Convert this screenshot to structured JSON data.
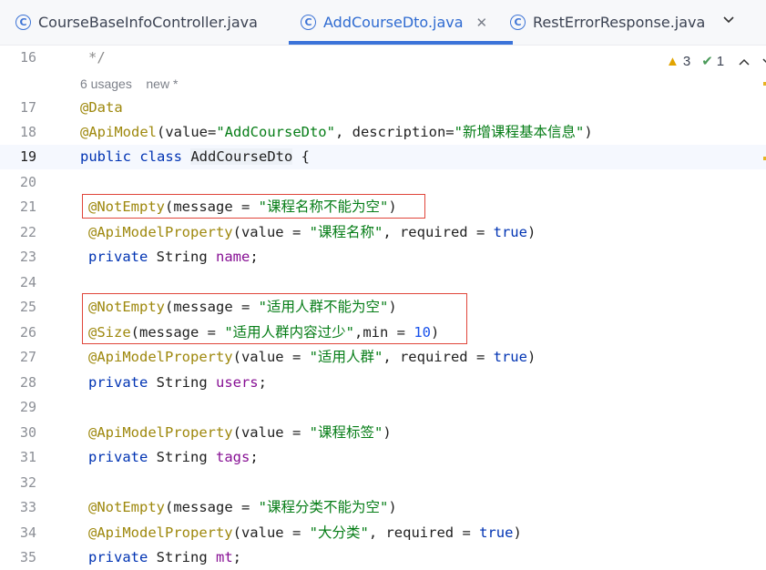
{
  "tabs": [
    {
      "label": "CourseBaseInfoController.java",
      "active": false
    },
    {
      "label": "AddCourseDto.java",
      "active": true
    },
    {
      "label": "RestErrorResponse.java",
      "active": false
    }
  ],
  "inspection": {
    "warnings": "3",
    "ok": "1"
  },
  "usages": {
    "count": "6 usages",
    "status": "new *"
  },
  "lines": {
    "l16": "16",
    "l17": "17",
    "l18": "18",
    "l19": "19",
    "l20": "20",
    "l21": "21",
    "l22": "22",
    "l23": "23",
    "l24": "24",
    "l25": "25",
    "l26": "26",
    "l27": "27",
    "l28": "28",
    "l29": "29",
    "l30": "30",
    "l31": "31",
    "l32": "32",
    "l33": "33",
    "l34": "34",
    "l35": "35"
  },
  "code": {
    "c16": "*/",
    "c17_ann": "@Data",
    "c18_ann": "@ApiModel",
    "c18_a": "(value=",
    "c18_s1": "\"AddCourseDto\"",
    "c18_b": ", description=",
    "c18_s2": "\"新增课程基本信息\"",
    "c18_c": ")",
    "c19_kw": "public class ",
    "c19_name": "AddCourseDto",
    "c19_b": " {",
    "c21_ann": "@NotEmpty",
    "c21_a": "(message = ",
    "c21_s": "\"课程名称不能为空\"",
    "c21_b": ")",
    "c22_ann": "@ApiModelProperty",
    "c22_a": "(value = ",
    "c22_s": "\"课程名称\"",
    "c22_b": ", required = ",
    "c22_kw": "true",
    "c22_c": ")",
    "c23_kw": "private ",
    "c23_t": "String ",
    "c23_f": "name",
    "c23_e": ";",
    "c25_ann": "@NotEmpty",
    "c25_a": "(message = ",
    "c25_s": "\"适用人群不能为空\"",
    "c25_b": ")",
    "c26_ann": "@Size",
    "c26_a": "(message = ",
    "c26_s": "\"适用人群内容过少\"",
    "c26_b": ",min = ",
    "c26_n": "10",
    "c26_c": ")",
    "c27_ann": "@ApiModelProperty",
    "c27_a": "(value = ",
    "c27_s": "\"适用人群\"",
    "c27_b": ", required = ",
    "c27_kw": "true",
    "c27_c": ")",
    "c28_kw": "private ",
    "c28_t": "String ",
    "c28_f": "users",
    "c28_e": ";",
    "c30_ann": "@ApiModelProperty",
    "c30_a": "(value = ",
    "c30_s": "\"课程标签\"",
    "c30_b": ")",
    "c31_kw": "private ",
    "c31_t": "String ",
    "c31_f": "tags",
    "c31_e": ";",
    "c33_ann": "@NotEmpty",
    "c33_a": "(message = ",
    "c33_s": "\"课程分类不能为空\"",
    "c33_b": ")",
    "c34_ann": "@ApiModelProperty",
    "c34_a": "(value = ",
    "c34_s": "\"大分类\"",
    "c34_b": ", required = ",
    "c34_kw": "true",
    "c34_c": ")",
    "c35_kw": "private ",
    "c35_t": "String ",
    "c35_f": "mt",
    "c35_e": ";"
  }
}
